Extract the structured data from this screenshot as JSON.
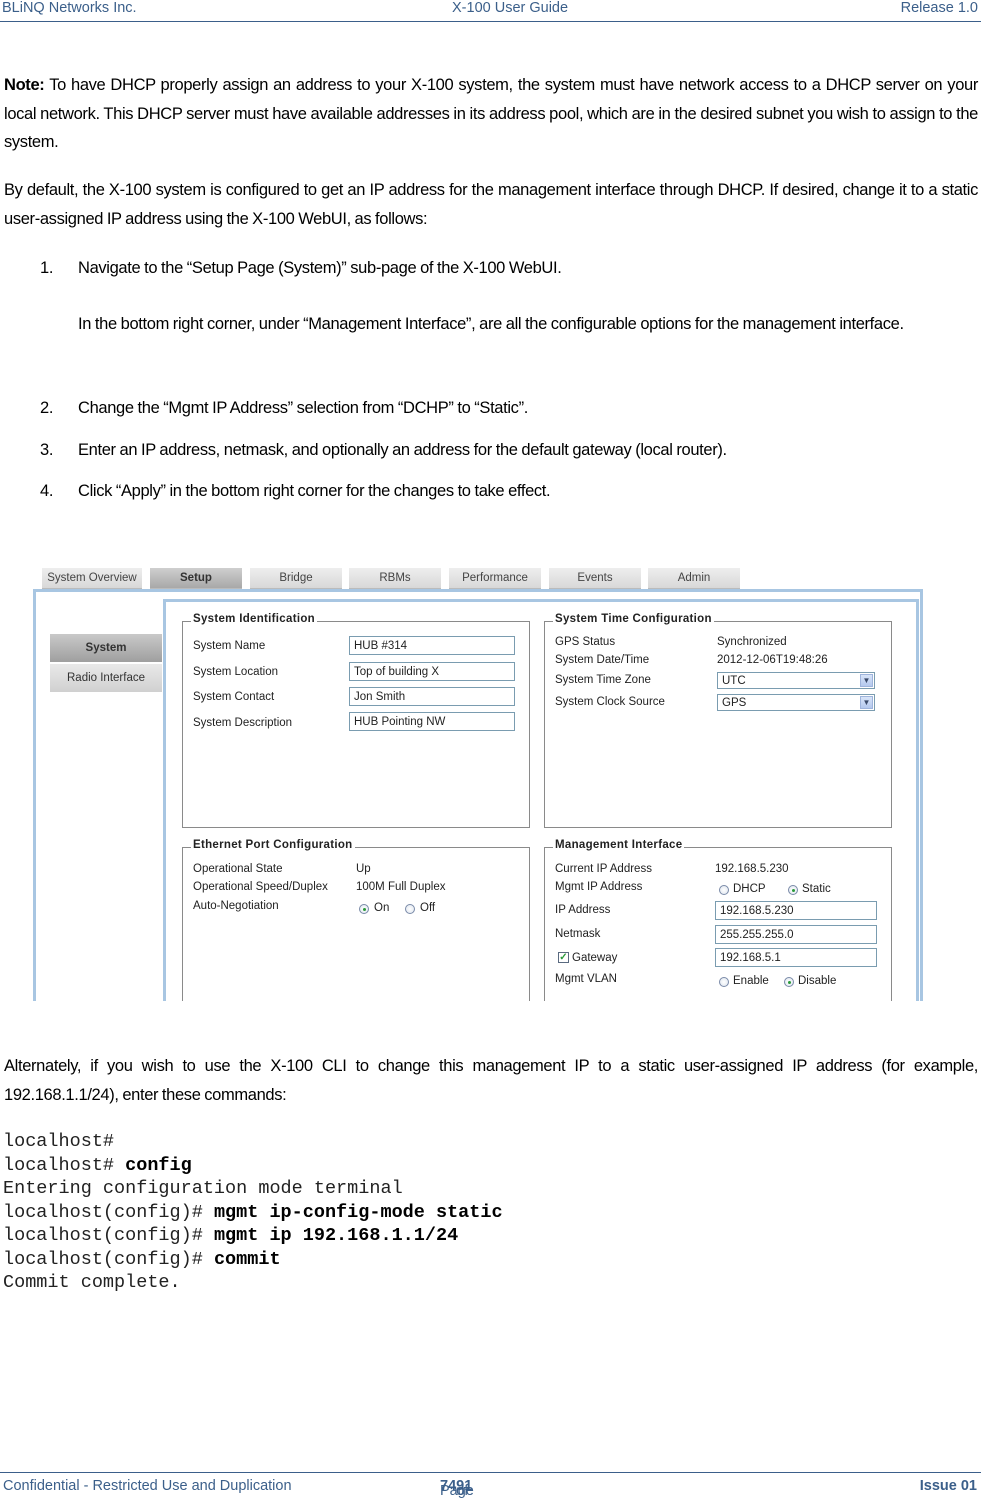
{
  "header": {
    "company": "BLiNQ Networks Inc.",
    "title": "X-100 User Guide",
    "release": "Release 1.0"
  },
  "body": {
    "note_label": "Note:",
    "note_text": " To have DHCP properly assign an address to your X-100 system, the system must have network access to a DHCP server on your local network. This DHCP server must have available addresses in its address pool, which are in the desired subnet you wish to assign to the system.",
    "default_text": "By default, the X-100 system is configured to get an IP address for the management interface through DHCP. If desired, change it to a static user-assigned IP address using the X-100 WebUI, as follows:",
    "steps": [
      {
        "num": "1.",
        "text": "Navigate to the “Setup Page (System)” sub-page of the X-100 WebUI."
      },
      {
        "num": "2.",
        "text": "Change the “Mgmt IP Address” selection from “DCHP” to “Static”."
      },
      {
        "num": "3.",
        "text": "Enter an IP address, netmask, and optionally an address for the default gateway (local router)."
      },
      {
        "num": "4.",
        "text": "Click “Apply” in the bottom right corner for the changes to take effect."
      }
    ],
    "step1_sub": "In the bottom right corner, under “Management Interface”, are all the configurable options for the management interface.",
    "alt_text": "Alternately, if you wish to use the X-100 CLI to change this management IP to a static user-assigned IP address (for example, 192.168.1.1/24), enter these commands:"
  },
  "webui": {
    "tabs": [
      {
        "label": "System Overview",
        "active": false
      },
      {
        "label": "Setup",
        "active": true
      },
      {
        "label": "Bridge",
        "active": false
      },
      {
        "label": "RBMs",
        "active": false
      },
      {
        "label": "Performance",
        "active": false
      },
      {
        "label": "Events",
        "active": false
      },
      {
        "label": "Admin",
        "active": false
      }
    ],
    "sidebar": [
      {
        "label": "System",
        "active": true
      },
      {
        "label": "Radio Interface",
        "active": false
      }
    ],
    "system_identification": {
      "title": "System Identification",
      "fields": [
        {
          "label": "System Name",
          "value": "HUB #314"
        },
        {
          "label": "System Location",
          "value": "Top of building X"
        },
        {
          "label": "System Contact",
          "value": "Jon Smith"
        },
        {
          "label": "System Description",
          "value": "HUB Pointing NW"
        }
      ]
    },
    "system_time": {
      "title": "System Time Configuration",
      "gps_status_label": "GPS Status",
      "gps_status_value": "Synchronized",
      "datetime_label": "System Date/Time",
      "datetime_value": "2012-12-06T19:48:26",
      "timezone_label": "System Time Zone",
      "timezone_value": "UTC",
      "clock_label": "System Clock Source",
      "clock_value": "GPS"
    },
    "ethernet": {
      "title": "Ethernet Port Configuration",
      "op_state_label": "Operational State",
      "op_state_value": "Up",
      "speed_label": "Operational Speed/Duplex",
      "speed_value": "100M Full Duplex",
      "autoneg_label": "Auto-Negotiation",
      "autoneg_on": "On",
      "autoneg_off": "Off",
      "autoneg_selected": "On"
    },
    "mgmt": {
      "title": "Management Interface",
      "current_ip_label": "Current IP Address",
      "current_ip_value": "192.168.5.230",
      "mode_label": "Mgmt IP Address",
      "mode_dhcp": "DHCP",
      "mode_static": "Static",
      "mode_selected": "Static",
      "ip_label": "IP Address",
      "ip_value": "192.168.5.230",
      "netmask_label": "Netmask",
      "netmask_value": "255.255.255.0",
      "gateway_label": "Gateway",
      "gateway_checked": true,
      "gateway_value": "192.168.5.1",
      "vlan_label": "Mgmt VLAN",
      "vlan_enable": "Enable",
      "vlan_disable": "Disable",
      "vlan_selected": "Disable"
    }
  },
  "cli": [
    {
      "prompt": "localhost#",
      "cmd": ""
    },
    {
      "prompt": "localhost# ",
      "cmd": "config"
    },
    {
      "prompt": "Entering configuration mode terminal",
      "cmd": ""
    },
    {
      "prompt": "localhost(config)# ",
      "cmd": "mgmt ip-config-mode static"
    },
    {
      "prompt": "localhost(config)# ",
      "cmd": "mgmt ip 192.168.1.1/24"
    },
    {
      "prompt": "localhost(config)# ",
      "cmd": "commit"
    },
    {
      "prompt": "Commit complete.",
      "cmd": ""
    }
  ],
  "footer": {
    "confidential": "Confidential - Restricted Use and Duplication",
    "page_prefix": "Page ",
    "page_num": "74",
    "page_of": " of ",
    "page_total": "91",
    "issue": "Issue 01"
  }
}
